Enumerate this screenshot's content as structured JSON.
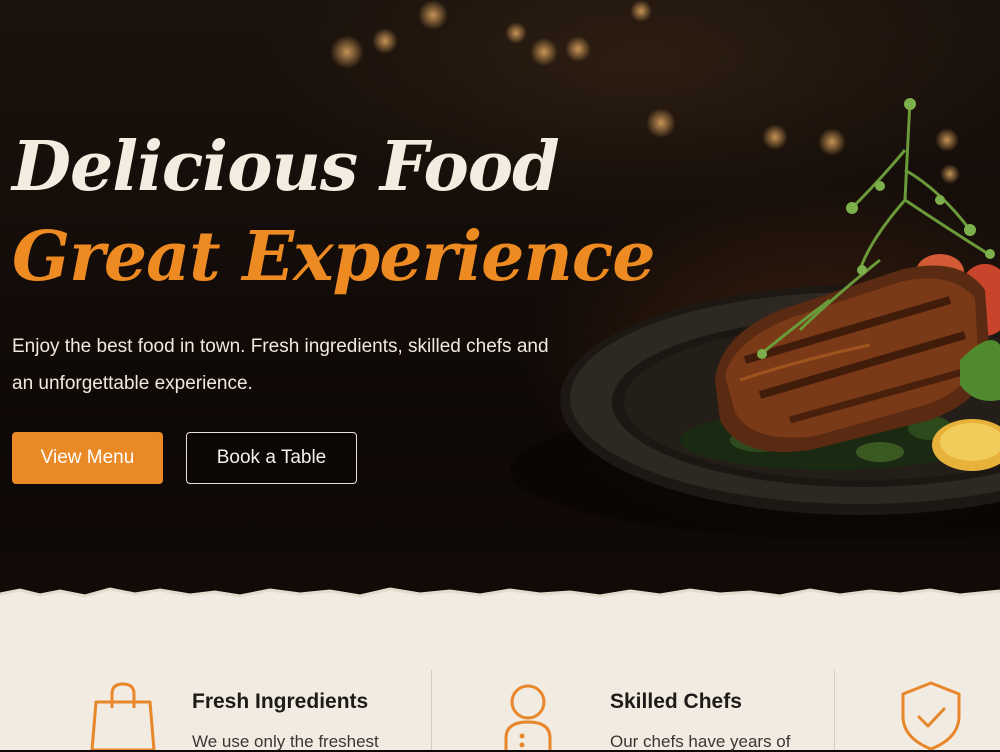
{
  "hero": {
    "title_line1": "Delicious Food",
    "title_line2": "Great Experience",
    "subtitle": "Enjoy the best food in town. Fresh ingredients, skilled chefs and an unforgettable experience.",
    "primary_button": "View Menu",
    "secondary_button": "Book a Table"
  },
  "features": [
    {
      "icon": "shopping-bag-icon",
      "title": "Fresh Ingredients",
      "description": "We use only the freshest"
    },
    {
      "icon": "chef-icon",
      "title": "Skilled Chefs",
      "description": "Our chefs have years of"
    },
    {
      "icon": "shield-check-icon",
      "title": "",
      "description": ""
    }
  ],
  "colors": {
    "accent": "#ea8a26",
    "cream": "#f1ebe1",
    "dark": "#0d0806"
  }
}
